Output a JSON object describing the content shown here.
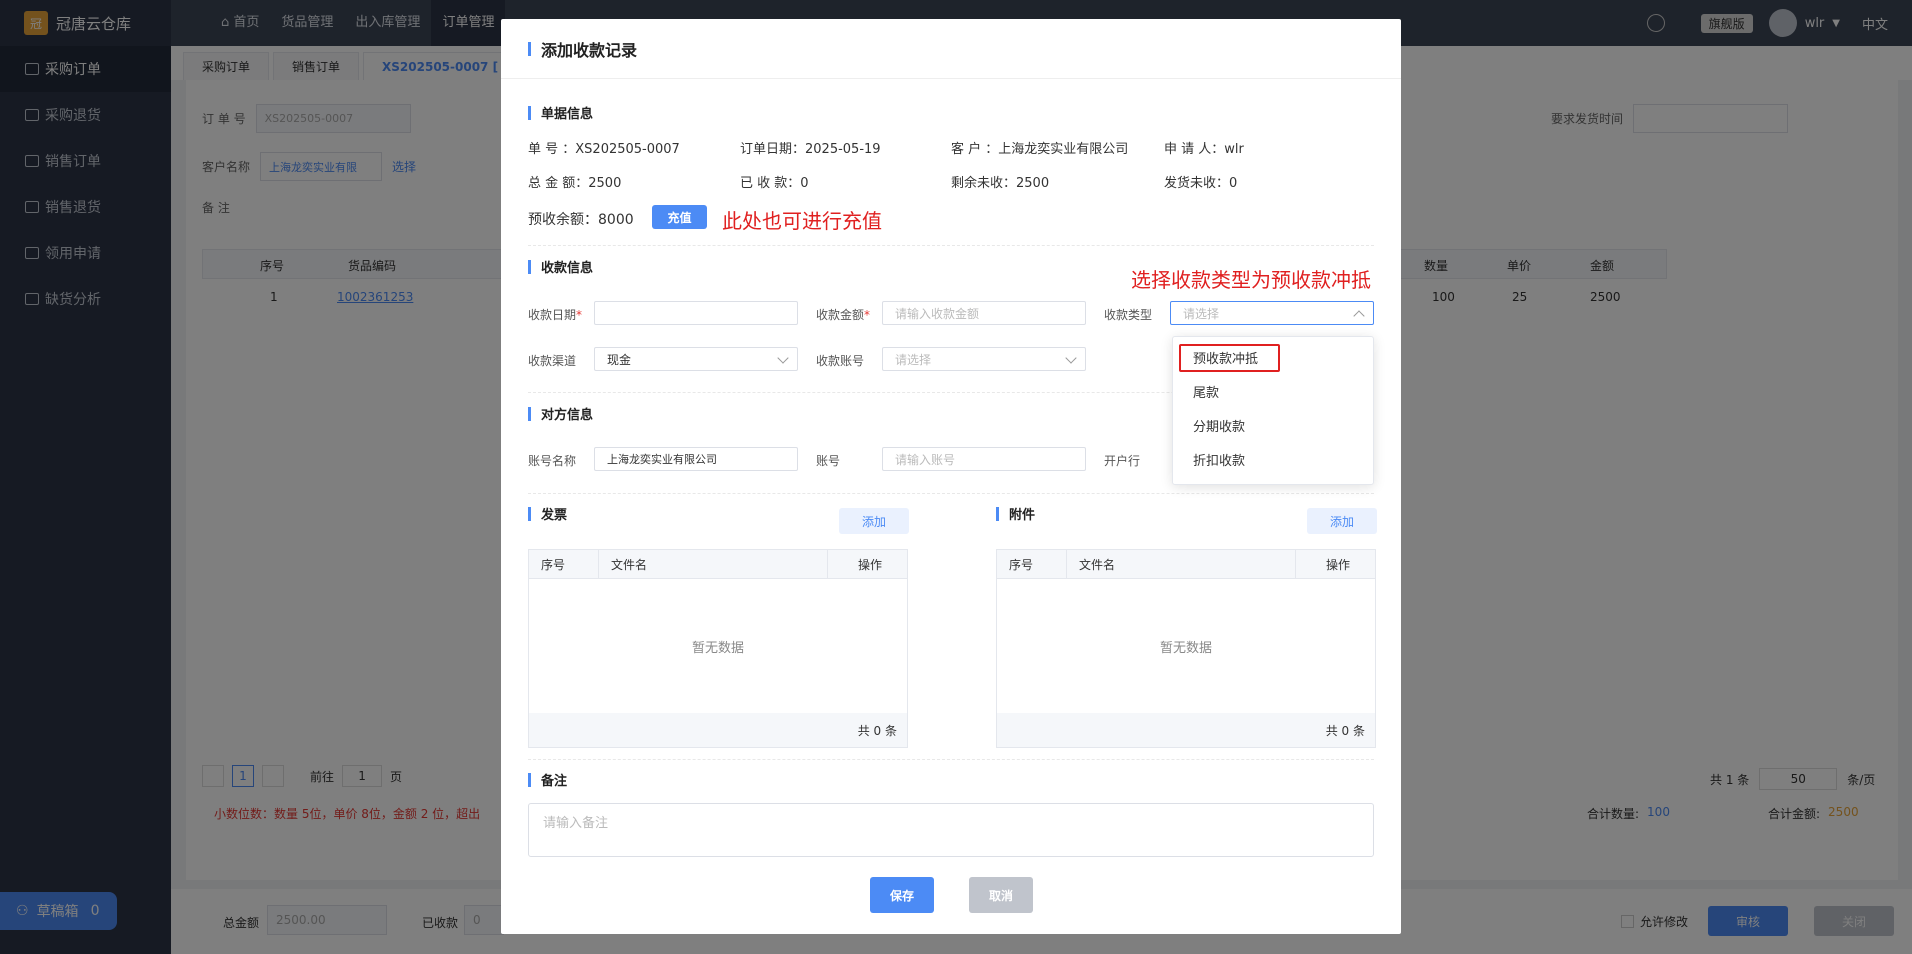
{
  "app": {
    "name": "冠唐云仓库",
    "logo": "冠"
  },
  "topnav": [
    "首页",
    "货品管理",
    "出入库管理",
    "订单管理"
  ],
  "topright": {
    "edition": "旗舰版",
    "user": "wlr",
    "lang": "中文"
  },
  "sidebar": {
    "items": [
      "采购订单",
      "采购退货",
      "销售订单",
      "销售退货",
      "领用申请",
      "缺货分析"
    ],
    "draft_label": "草稿箱",
    "draft_count": "0"
  },
  "tabs": [
    "采购订单",
    "销售订单",
    "XS202505-0007 ["
  ],
  "bg": {
    "order_no_label": "订  单  号",
    "order_no": "XS202505-0007",
    "customer_label": "客户名称",
    "customer": "上海龙奕实业有限",
    "choose": "选择",
    "remark_label": "备   注",
    "col_seq": "序号",
    "col_code": "货品编码",
    "row_seq": "1",
    "row_code": "1002361253",
    "col_qty": "数量",
    "col_price": "单价",
    "col_amt": "金额",
    "qty": "100",
    "price": "25",
    "amt": "2500",
    "req_ship_time": "要求发货时间",
    "decimals": "小数位数：数量 5位，单价 8位，金额 2 位，超出",
    "goto": "前往",
    "page_input": "1",
    "page_unit": "页",
    "page_cur": "1",
    "total_count": "共 1 条",
    "page_size": "50",
    "page_size_unit": "条/页",
    "sum_qty_label": "合计数量:",
    "sum_qty": "100",
    "sum_amt_label": "合计金额:",
    "sum_amt": "2500",
    "total_amount_label": "总金额",
    "total_amount": "2500.00",
    "received_label": "已收款",
    "received": "0",
    "allow_modify": "允许修改",
    "audit": "审核",
    "close": "关闭"
  },
  "modal": {
    "title": "添加收款记录",
    "doc_section": "单据信息",
    "doc_no": "单      号  ：XS202505-0007",
    "doc_date": "订单日期：2025-05-19",
    "doc_customer": "客      户  ：上海龙奕实业有限公司",
    "doc_applicant": "申  请  人：wlr",
    "doc_total": "总  金  额：2500",
    "doc_received": "已  收  款：0",
    "doc_remaining": "剩余未收：2500",
    "doc_unshipped": "发货未收：0",
    "prepaid_balance": "预收余额：8000",
    "recharge_btn": "充值",
    "pay_section": "收款信息",
    "pay_date_label": "收款日期",
    "pay_amount_label": "收款金额",
    "pay_amount_ph": "请输入收款金额",
    "pay_type_label": "收款类型",
    "pay_type_ph": "请选择",
    "channel_label": "收款渠道",
    "channel_value": "现金",
    "account_label": "收款账号",
    "account_ph": "请选择",
    "party_section": "对方信息",
    "acct_name_label": "账号名称",
    "acct_name_value": "上海龙奕实业有限公司",
    "acct_no_label": "账号",
    "acct_no_ph": "请输入账号",
    "bank_label": "开户行",
    "invoice_section": "发票",
    "attach_section": "附件",
    "add_btn": "添加",
    "col_seq": "序号",
    "col_file": "文件名",
    "col_op": "操作",
    "empty": "暂无数据",
    "total_zero": "共 0 条",
    "remark_section": "备注",
    "remark_ph": "请输入备注",
    "save": "保存",
    "cancel": "取消"
  },
  "dropdown": [
    "预收款冲抵",
    "尾款",
    "分期收款",
    "折扣收款"
  ],
  "annotations": {
    "recharge_note": "此处也可进行充值",
    "type_note": "选择收款类型为预收款冲抵"
  }
}
